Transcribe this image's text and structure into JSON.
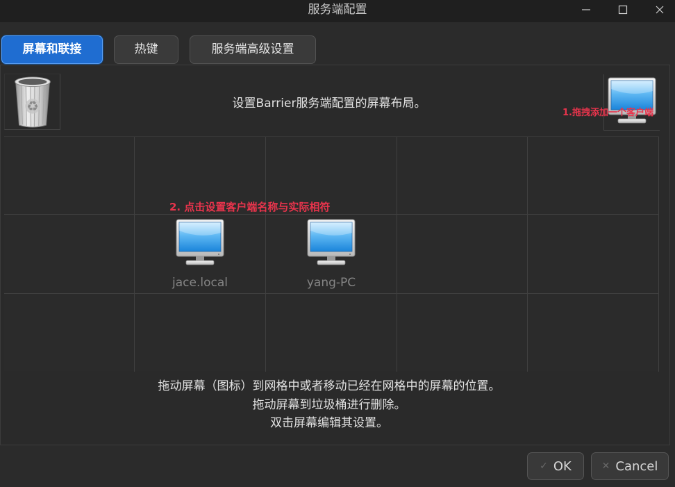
{
  "window": {
    "title": "服务端配置",
    "controls": {
      "minimize": "minimize-icon",
      "maximize": "maximize-icon",
      "close": "close-icon"
    }
  },
  "tabs": [
    {
      "label": "屏幕和联接",
      "active": true
    },
    {
      "label": "热键",
      "active": false
    },
    {
      "label": "服务端高级设置",
      "active": false
    }
  ],
  "screens_panel": {
    "description": "设置Barrier服务端配置的屏幕布局。",
    "trash": {
      "icon": "trash-icon"
    },
    "new_screen": {
      "icon": "monitor-icon"
    },
    "annotations": {
      "add_client": "1.拖拽添加一个客户端",
      "set_client_name": "2. 点击设置客户端名称与实际相符"
    },
    "screens": [
      {
        "name": "jace.local",
        "icon": "monitor-icon"
      },
      {
        "name": "yang-PC",
        "icon": "monitor-icon"
      }
    ],
    "instructions": [
      "拖动屏幕（图标）到网格中或者移动已经在网格中的屏幕的位置。",
      "拖动屏幕到垃圾桶进行删除。",
      "双击屏幕编辑其设置。"
    ]
  },
  "buttons": {
    "ok": {
      "label": "OK",
      "icon": "check-icon"
    },
    "cancel": {
      "label": "Cancel",
      "icon": "cross-icon"
    }
  },
  "colors": {
    "accent": "#1f6dd1",
    "annotation": "#e8344c",
    "background": "#2b2b2b"
  }
}
